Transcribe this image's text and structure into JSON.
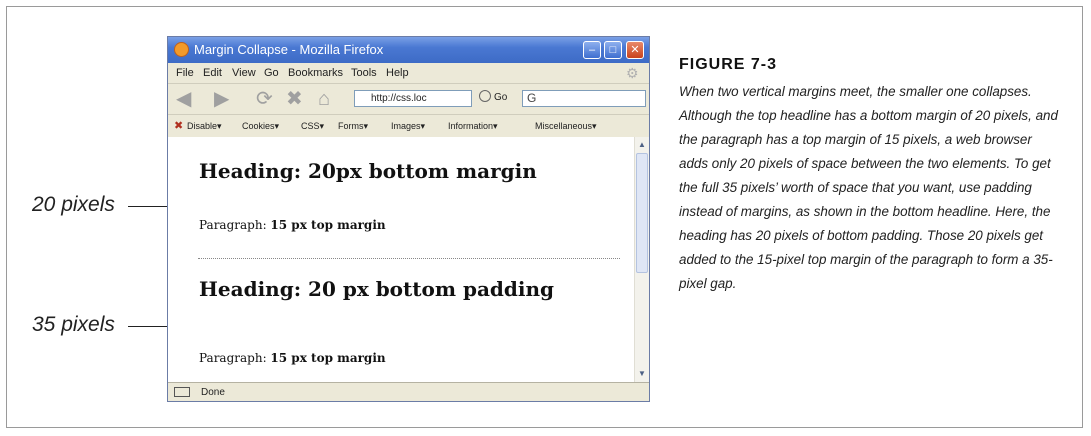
{
  "callouts": {
    "top": "20 pixels",
    "bottom": "35 pixels"
  },
  "browser": {
    "title": "Margin Collapse - Mozilla Firefox",
    "menu": [
      "File",
      "Edit",
      "View",
      "Go",
      "Bookmarks",
      "Tools",
      "Help"
    ],
    "url": "http://css.loc",
    "go_label": "Go",
    "search_value": "G",
    "webdev_toolbar": [
      "Disable▾",
      "Cookies▾",
      "CSS▾",
      "Forms▾",
      "Images▾",
      "Information▾",
      "Miscellaneous▾"
    ],
    "status": "Done"
  },
  "page": {
    "heading1": "Heading: 20px bottom margin",
    "para1_label": "Paragraph: ",
    "para1_bold": "15 px top margin",
    "heading2": "Heading: 20 px bottom padding",
    "para2_label": "Paragraph: ",
    "para2_bold": "15 px top margin"
  },
  "figure": {
    "title": "FIGURE 7-3",
    "caption": "When two vertical margins meet, the smaller one collapses. Although the top headline has a bottom margin of 20 pixels, and the paragraph has a top margin of 15 pixels, a web browser adds only 20 pixels of space between the two elements. To get the full 35 pixels’ worth of space that you want, use padding instead of margins, as shown in the bottom headline. Here, the heading has 20 pixels of bottom padding. Those 20 pixels get added to the 15-pixel top margin of the paragraph to form a 35-pixel gap."
  }
}
